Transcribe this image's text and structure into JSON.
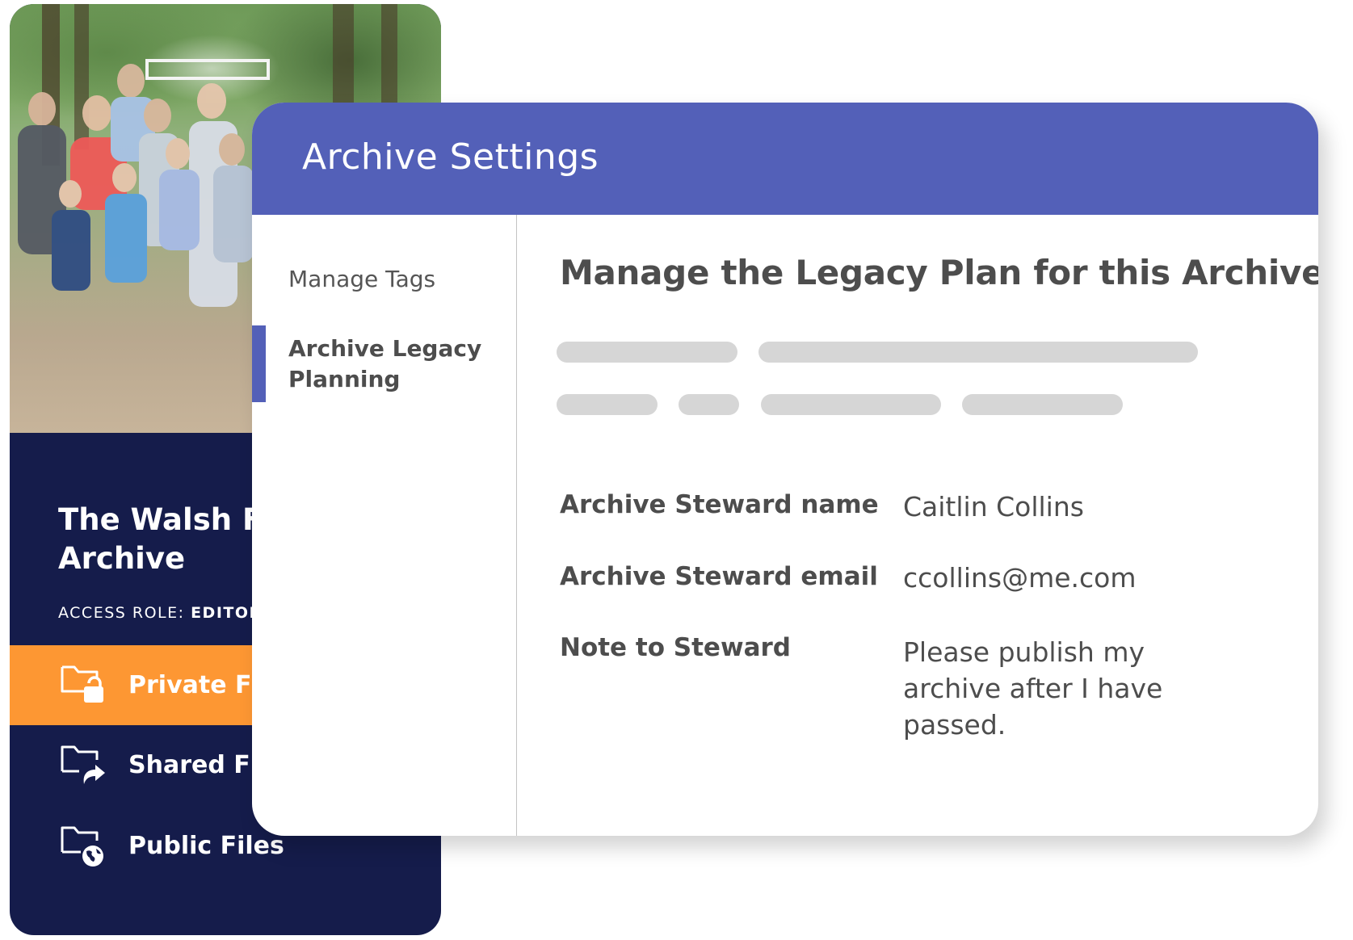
{
  "archive_card": {
    "photo_alt": "family-photo",
    "title": "The Walsh Family\nArchive",
    "access_role_label": "ACCESS ROLE:",
    "access_role_value": "EDITOR",
    "nav": [
      {
        "label": "Private Files",
        "icon": "folder-lock-icon",
        "active": true
      },
      {
        "label": "Shared Files",
        "icon": "folder-share-icon",
        "active": false
      },
      {
        "label": "Public Files",
        "icon": "folder-globe-icon",
        "active": false
      }
    ]
  },
  "settings": {
    "title": "Archive Settings",
    "sidebar": [
      {
        "label": "Manage Tags",
        "active": false
      },
      {
        "label": "Archive Legacy Planning",
        "active": true
      }
    ],
    "heading": "Manage the Legacy Plan for this Archive",
    "fields": [
      {
        "label": "Archive Steward name",
        "value": "Caitlin Collins"
      },
      {
        "label": "Archive Steward email",
        "value": "ccollins@me.com"
      },
      {
        "label": "Note to Steward",
        "value": "Please publish my archive after I have passed."
      }
    ]
  },
  "colors": {
    "header": "#5360b8",
    "navy": "#151c4b",
    "orange": "#fd9733",
    "text": "#4d4d4d",
    "skeleton": "#d6d6d6"
  }
}
